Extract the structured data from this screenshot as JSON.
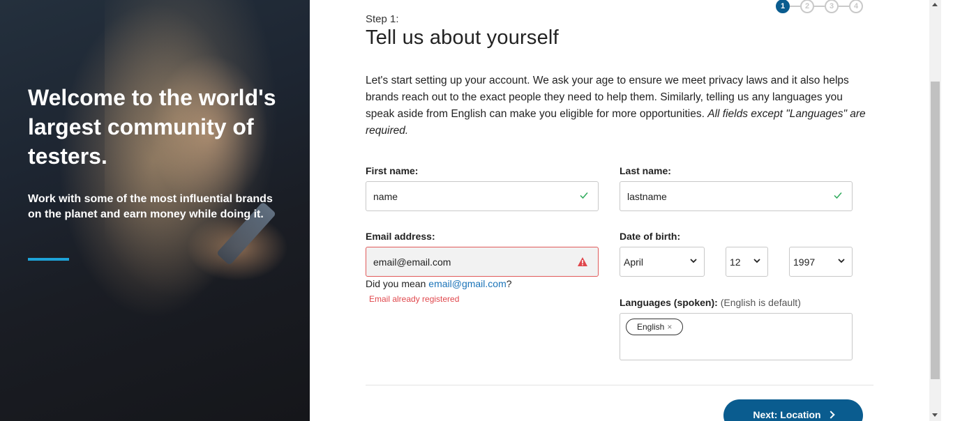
{
  "hero": {
    "title": "Welcome to the world's largest community of testers.",
    "subtitle": "Work with some of the most influential brands on the planet and earn money while doing it.",
    "accent_color": "#1ea3d8"
  },
  "stepper": {
    "steps": [
      "1",
      "2",
      "3",
      "4"
    ],
    "active_step": 1,
    "active_color": "#0a5c8f"
  },
  "form": {
    "step_label": "Step 1:",
    "title": "Tell us about yourself",
    "intro_text": "Let's start setting up your account. We ask your age to ensure we meet privacy laws and it also helps brands reach out to the exact people they need to help them. Similarly, telling us any languages you speak aside from English can make you eligible for more opportunities. ",
    "intro_emphasis": "All fields except \"Languages\" are required.",
    "first_name": {
      "label": "First name:",
      "value": "name",
      "status": "valid"
    },
    "last_name": {
      "label": "Last name:",
      "value": "lastname",
      "status": "valid"
    },
    "email": {
      "label": "Email address:",
      "value": "email@email.com",
      "status": "error",
      "suggestion_prefix": "Did you mean ",
      "suggestion_link": "email@gmail.com",
      "suggestion_suffix": "?",
      "error_message": "Email already registered",
      "error_color": "#e0474c"
    },
    "dob": {
      "label": "Date of birth:",
      "month": "April",
      "day": "12",
      "year": "1997"
    },
    "languages": {
      "label": "Languages (spoken):",
      "hint": "(English is default)",
      "tags": [
        {
          "label": "English",
          "remove": "×"
        }
      ]
    },
    "next_button": {
      "label": "Next: Location",
      "icon": "chevron-right-icon"
    },
    "valid_color": "#2eaa5b",
    "link_color": "#1a73b8"
  }
}
